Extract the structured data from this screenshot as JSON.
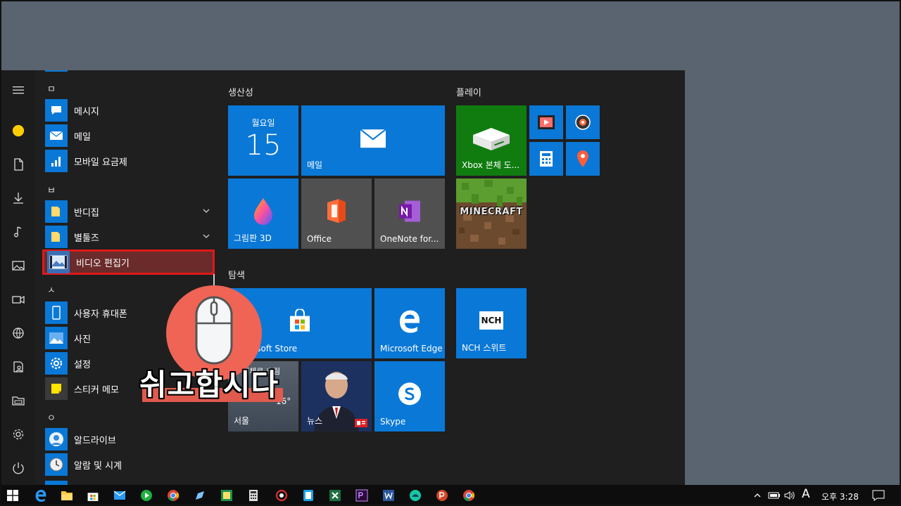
{
  "rail": {
    "icons": [
      "hamburger-icon",
      "user-avatar-icon",
      "document-icon",
      "download-icon",
      "music-icon",
      "pictures-icon",
      "video-icon",
      "network-icon",
      "user-folder-icon",
      "file-explorer-icon",
      "gear-icon",
      "power-icon"
    ]
  },
  "applist": {
    "letters": {
      "m": "ㅁ",
      "b": "ㅂ",
      "s": "ㅅ",
      "o": "ㅇ"
    },
    "apps": {
      "messages": "메시지",
      "mail": "메일",
      "mobile_plans": "모바일 요금제",
      "bandizip": "반디집",
      "sticky_folder": "별툴즈",
      "video_editor": "비디오 편집기",
      "your_phone": "사용자 휴대폰",
      "photos": "사진",
      "settings": "설정",
      "sticky_notes": "스티커 메모",
      "alzip_drive": "알드라이브",
      "alarms": "알람 및 시계"
    }
  },
  "groups": {
    "productivity": "생산성",
    "play": "플레이",
    "explore": "탐색"
  },
  "tiles": {
    "calendar_day": "월요일",
    "calendar_date": "15",
    "mail": "메일",
    "xbox": "Xbox 본체 도...",
    "paint3d": "그림판 3D",
    "office": "Office",
    "onenote": "OneNote for...",
    "store": "Microsoft Store",
    "edge": "Microsoft Edge",
    "nch": "NCH 스위트",
    "nch_logo": "NCH",
    "weather_top": "대체로 흐림",
    "weather_temp": "16°",
    "weather_city": "서울",
    "news": "뉴스",
    "skype": "Skype",
    "minecraft": "MINECRAFT"
  },
  "overlay": {
    "caption": "쉬고합시다"
  },
  "taskbar": {
    "ime": "A",
    "clock": "오후 3:28"
  },
  "colors": {
    "tile_blue": "#0a78d7",
    "selection_border": "#e01818",
    "caption_accent": "#ef6455"
  }
}
